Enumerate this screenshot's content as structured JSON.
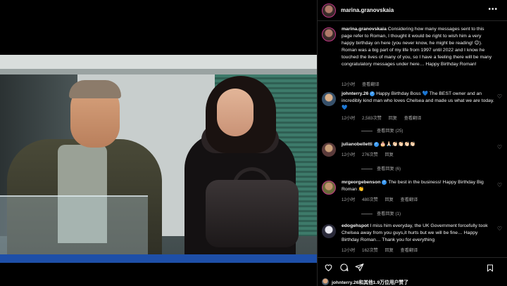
{
  "post": {
    "username": "marina.granovskaia",
    "caption_username": "marina.granovskaia",
    "caption": "Considering how many messages sent to this page refer to Roman, I thought it would be right to wish him a very happy birthday on here (you never know, he might be reading! 😉). Roman was a big part of my life from 1997 until 2022 and I know he touched the lives of many of you, so I have a feeling there will be many congratulatory messages under here… Happy Birthday Roman!",
    "caption_time": "12小时",
    "caption_translate": "查看翻译"
  },
  "comments": [
    {
      "username": "johnterry.26",
      "verified": true,
      "text": "Happy Birthday Boss 💙 The BEST owner and an incredibly kind man who loves Chelsea and made us what we are today. 💙",
      "time": "12小时",
      "likes": "2,583次赞",
      "reply": "回复",
      "translate": "查看翻译",
      "view_replies": "查看回复 (25)"
    },
    {
      "username": "julianobelletti",
      "verified": true,
      "text": "🎂🙏🏻👏🏻👏🏻👏🏻👏🏻",
      "time": "12小时",
      "likes": "276次赞",
      "reply": "回复",
      "translate": "",
      "view_replies": "查看回复 (6)"
    },
    {
      "username": "mrgeorgebenson",
      "verified": true,
      "text": "The best in the business! Happy Birthday Big Roman 👏",
      "time": "12小时",
      "likes": "480次赞",
      "reply": "回复",
      "translate": "查看翻译",
      "view_replies": "查看回复 (1)"
    },
    {
      "username": "edogehspot",
      "verified": false,
      "text": "I miss him everyday, the UK Government forcefully took Chelsea away from you guys,it hurts but we will be fine… Happy Birthday Roman… Thank you for everything",
      "time": "12小时",
      "likes": "162次赞",
      "reply": "回复",
      "translate": "查看翻译",
      "view_replies": ""
    }
  ],
  "likes_line": {
    "text": "johnterry.26和其他1.9万位用户赞了"
  },
  "icons": {
    "more": "more-horizontal-icon",
    "heart": "heart-outline-icon",
    "comment": "comment-icon",
    "share": "paper-plane-icon",
    "save": "bookmark-icon"
  }
}
